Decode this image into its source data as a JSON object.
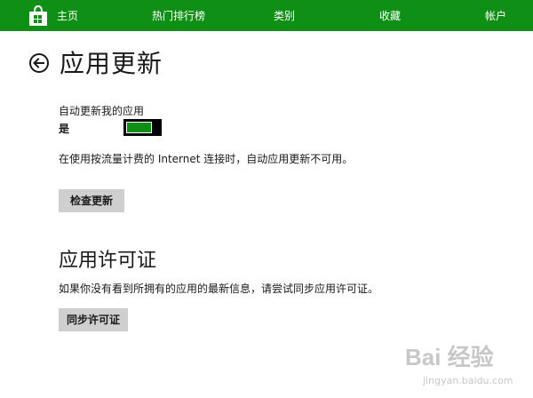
{
  "nav": {
    "home_label": "主页",
    "top_charts_label": "热门排行榜",
    "categories_label": "类别",
    "favorites_label": "收藏",
    "account_label": "帐户",
    "accent_color": "#0f8f15"
  },
  "page": {
    "title": "应用更新",
    "back_icon": "back-arrow-icon"
  },
  "auto_update": {
    "label": "自动更新我的应用",
    "state_text": "是",
    "enabled": true,
    "note": "在使用按流量计费的 Internet 连接时，自动应用更新不可用。",
    "check_button_label": "检查更新"
  },
  "license": {
    "title": "应用许可证",
    "description": "如果你没有看到所拥有的应用的最新信息，请尝试同步应用许可证。",
    "sync_button_label": "同步许可证"
  },
  "watermark": {
    "brand_text": "Bai 经验",
    "url_text": "jingyan.baidu.com"
  }
}
